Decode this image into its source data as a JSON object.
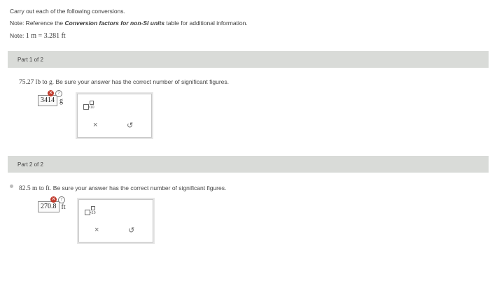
{
  "instructions": {
    "line1": "Carry out each of the following conversions.",
    "note_prefix": "Note: Reference the ",
    "note_bold": "Conversion factors for non-SI units",
    "note_suffix": " table for additional information.",
    "note2_prefix": "Note: ",
    "note2_math": "1 m = 3.281 ft"
  },
  "parts": [
    {
      "header": "Part 1 of 2",
      "quantity": "75.27",
      "from_unit": "lb",
      "to_word": "to",
      "to_unit": "g",
      "question_rest": ". Be sure your answer has the correct number of significant figures.",
      "answer_value": "3414",
      "answer_unit": "g",
      "status": "incorrect"
    },
    {
      "header": "Part 2 of 2",
      "quantity": "82.5",
      "from_unit": "m",
      "to_word": "to",
      "to_unit": "ft",
      "question_rest": ". Be sure your answer has the correct number of significant figures.",
      "answer_value": "270.8",
      "answer_unit": "ft",
      "status": "incorrect"
    }
  ],
  "toolbar": {
    "sci_icon": "scientific-notation-icon",
    "clear_symbol": "×",
    "undo_symbol": "↺"
  },
  "icons": {
    "error": "x-circle-icon",
    "info": "info-circle-icon"
  },
  "colors": {
    "header_bar": "#d9dbd8",
    "error": "#c0392b"
  }
}
